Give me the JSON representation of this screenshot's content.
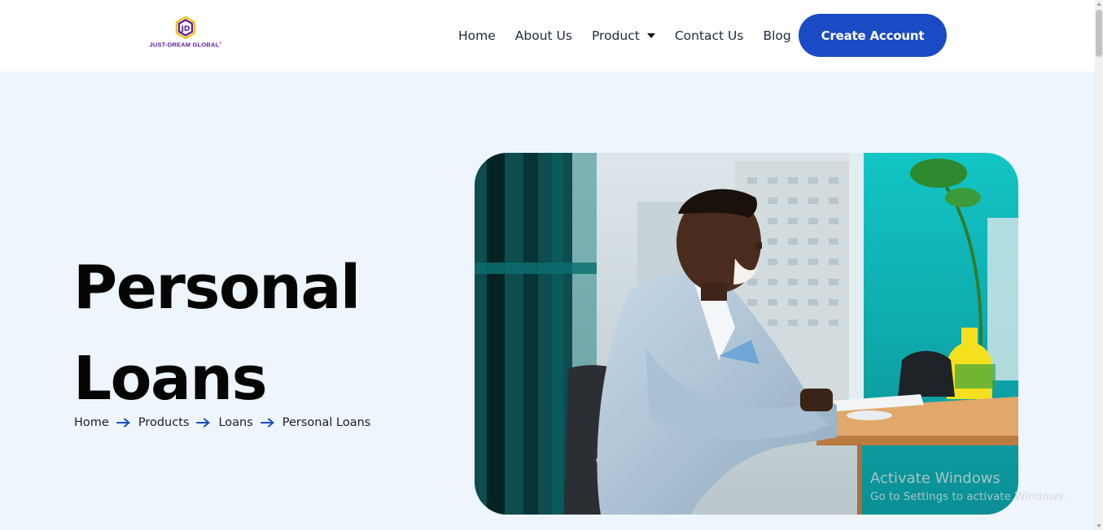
{
  "header": {
    "logo": {
      "text": "JUST-DREAM GLOBAL",
      "trademark": "®",
      "icon": "hexagon-logo-icon"
    },
    "nav": [
      {
        "label": "Home"
      },
      {
        "label": "About Us"
      },
      {
        "label": "Product",
        "has_dropdown": true,
        "icon": "caret-down-icon"
      },
      {
        "label": "Contact Us"
      },
      {
        "label": "Blog"
      }
    ],
    "cta_label": "Create Account"
  },
  "hero": {
    "title_line1": "Personal",
    "title_line2": "Loans",
    "breadcrumb": [
      "Home",
      "Products",
      "Loans",
      "Personal Loans"
    ],
    "breadcrumb_separator_icon": "arrow-right-icon",
    "image": "man-in-light-blue-suit-typing-at-office-desk-photo"
  },
  "watermark": {
    "line1": "Activate Windows",
    "line2": "Go to Settings to activate Windows."
  },
  "colors": {
    "accent": "#1a4bc4",
    "hero_background": "#eef5fd",
    "logo_purple": "#5a1a9b",
    "logo_yellow": "#f2c20d"
  }
}
